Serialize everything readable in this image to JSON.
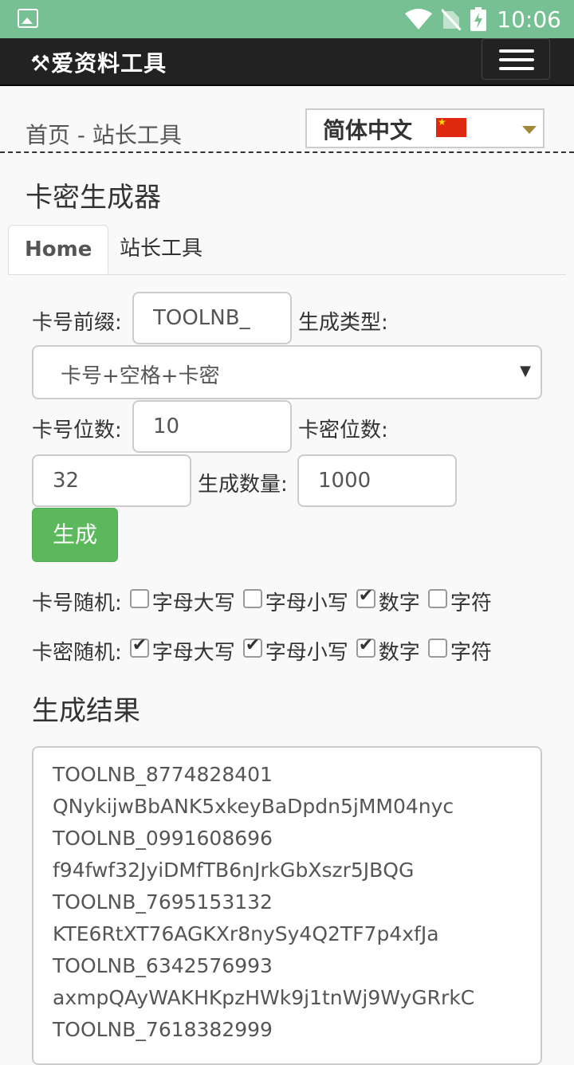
{
  "status": {
    "time": "10:06"
  },
  "nav": {
    "brand": "⚒爱资料工具"
  },
  "breadcrumb": "首页 - 站长工具",
  "language": {
    "selected": "简体中文"
  },
  "page_title": "卡密生成器",
  "tabs": [
    {
      "label": "Home"
    },
    {
      "label": "站长工具"
    }
  ],
  "form": {
    "prefix_label": "卡号前缀:",
    "prefix_value": "TOOLNB_",
    "type_label": "生成类型:",
    "type_value": "卡号+空格+卡密",
    "card_digits_label": "卡号位数:",
    "card_digits_value": "10",
    "pwd_digits_label": "卡密位数:",
    "pwd_digits_value": "32",
    "count_label": "生成数量:",
    "count_value": "1000",
    "generate_label": "生成"
  },
  "card_random": {
    "label": "卡号随机:",
    "options": [
      {
        "label": "字母大写",
        "checked": false
      },
      {
        "label": "字母小写",
        "checked": false
      },
      {
        "label": "数字",
        "checked": true
      },
      {
        "label": "字符",
        "checked": false
      }
    ]
  },
  "pwd_random": {
    "label": "卡密随机:",
    "options": [
      {
        "label": "字母大写",
        "checked": true
      },
      {
        "label": "字母小写",
        "checked": true
      },
      {
        "label": "数字",
        "checked": true
      },
      {
        "label": "字符",
        "checked": false
      }
    ]
  },
  "result": {
    "title": "生成结果",
    "lines": [
      "TOOLNB_8774828401",
      "QNykijwBbANK5xkeyBaDpdn5jMM04nyc",
      "TOOLNB_0991608696",
      "f94fwf32JyiDMfTB6nJrkGbXszr5JBQG",
      "TOOLNB_7695153132",
      "KTE6RtXT76AGKXr8nySy4Q2TF7p4xfJa",
      "TOOLNB_6342576993",
      "axmpQAyWAKHKpzHWk9j1tnWj9WyGRrkC",
      "TOOLNB_7618382999"
    ]
  }
}
